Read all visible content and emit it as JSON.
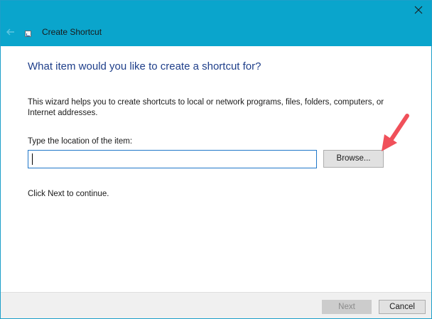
{
  "window": {
    "title": "Create Shortcut",
    "accent_color": "#0aa5cc"
  },
  "icons": {
    "back": "back-arrow-icon",
    "app": "shortcut-icon",
    "close": "close-icon",
    "annotation": "red-arrow-icon"
  },
  "content": {
    "heading": "What item would you like to create a shortcut for?",
    "description": "This wizard helps you to create shortcuts to local or network programs, files, folders, computers, or Internet addresses.",
    "location_label": "Type the location of the item:",
    "location_value": "",
    "browse_label": "Browse...",
    "continue_text": "Click Next to continue."
  },
  "footer": {
    "next_label": "Next",
    "cancel_label": "Cancel"
  },
  "colors": {
    "heading": "#1f3f8a",
    "input_border": "#2077c9",
    "annotation_arrow": "#f0505a"
  }
}
